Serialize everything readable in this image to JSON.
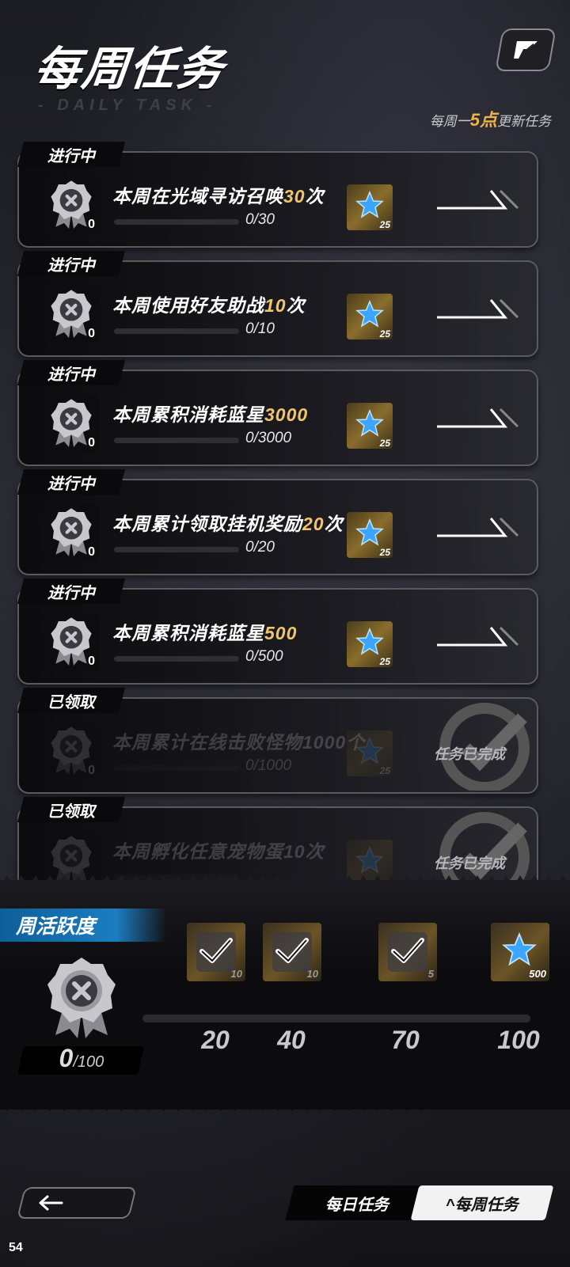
{
  "header": {
    "title": "每周任务",
    "subtitle": "- DAILY TASK -",
    "refresh_prefix": "每周一",
    "refresh_highlight": "5点",
    "refresh_suffix": "更新任务",
    "help_icon": "exit-icon"
  },
  "tasks": [
    {
      "status": "进行中",
      "text_main": "本周在光域寻访召唤",
      "text_hl": "30",
      "text_tail": "次",
      "progress_text": "0/30",
      "progress": 0,
      "badge_num": "0",
      "reward_count": "25",
      "action": "go"
    },
    {
      "status": "进行中",
      "text_main": "本周使用好友助战",
      "text_hl": "10",
      "text_tail": "次",
      "progress_text": "0/10",
      "progress": 0,
      "badge_num": "0",
      "reward_count": "25",
      "action": "go"
    },
    {
      "status": "进行中",
      "text_main": "本周累积消耗蓝星",
      "text_hl": "3000",
      "text_tail": "",
      "progress_text": "0/3000",
      "progress": 0,
      "badge_num": "0",
      "reward_count": "25",
      "action": "go"
    },
    {
      "status": "进行中",
      "text_main": "本周累计领取挂机奖励",
      "text_hl": "20",
      "text_tail": "次",
      "progress_text": "0/20",
      "progress": 0,
      "badge_num": "0",
      "reward_count": "25",
      "action": "go"
    },
    {
      "status": "进行中",
      "text_main": "本周累积消耗蓝星",
      "text_hl": "500",
      "text_tail": "",
      "progress_text": "0/500",
      "progress": 0,
      "badge_num": "0",
      "reward_count": "25",
      "action": "go"
    },
    {
      "status": "已领取",
      "text_main": "本周累计在线击败怪物1000个",
      "text_hl": "",
      "text_tail": "",
      "progress_text": "0/1000",
      "progress": 0,
      "badge_num": "0",
      "reward_count": "25",
      "action": "done",
      "done_label": "任务已完成"
    },
    {
      "status": "已领取",
      "text_main": "本周孵化任意宠物蛋10次",
      "text_hl": "",
      "text_tail": "",
      "progress_text": "",
      "progress": 0,
      "badge_num": "",
      "reward_count": "",
      "action": "done",
      "done_label": "任务已完成"
    }
  ],
  "activity": {
    "label": "周活跃度",
    "value": "0",
    "max": "/100",
    "progress": 0,
    "milestones": [
      {
        "label": "20",
        "count": "10",
        "icon": "helmet-icon",
        "claimed": true
      },
      {
        "label": "40",
        "count": "10",
        "icon": "armor-icon",
        "claimed": true
      },
      {
        "label": "70",
        "count": "5",
        "icon": "material-icon",
        "claimed": true
      },
      {
        "label": "100",
        "count": "500",
        "icon": "blue-star-icon",
        "claimed": false
      }
    ]
  },
  "nav": {
    "back_icon": "arrow-left-icon",
    "tab_daily": "每日任务",
    "tab_weekly": "每周任务"
  },
  "fps": "54",
  "colors": {
    "highlight": "#f2c46a",
    "accent_blue": "#1b7dc0"
  }
}
